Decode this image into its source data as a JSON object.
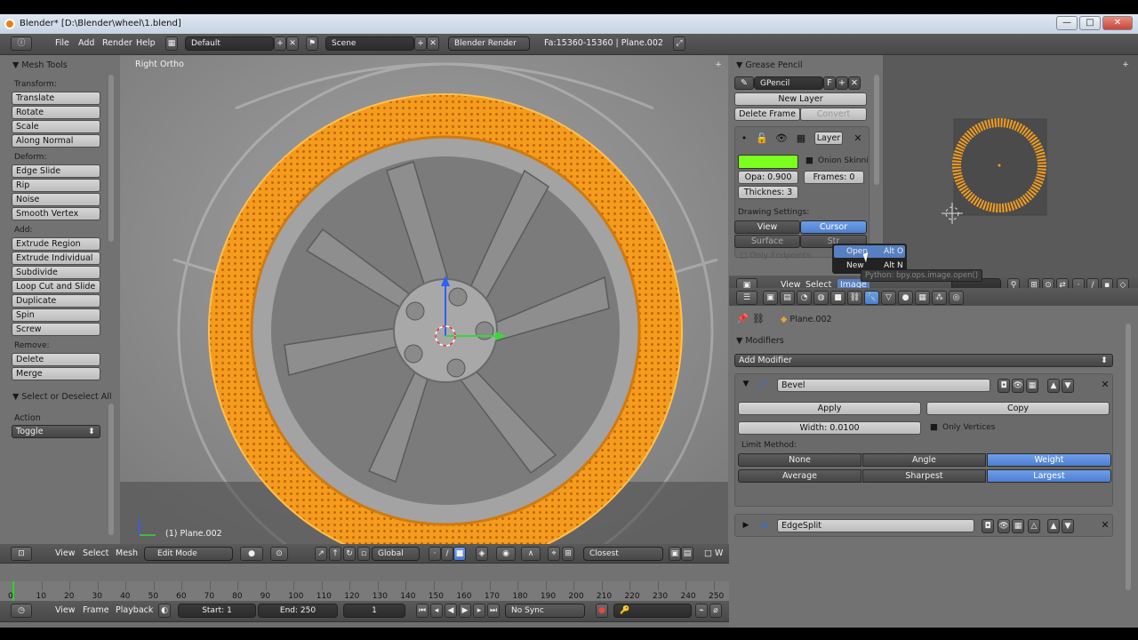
{
  "window": {
    "title": "Blender* [D:\\Blender\\wheel\\1.blend]",
    "minimize": "—",
    "maximize": "□",
    "close": "✕"
  },
  "top_header": {
    "menus": [
      "File",
      "Add",
      "Render",
      "Help"
    ],
    "layout": "Default",
    "scene": "Scene",
    "engine": "Blender Render",
    "stats": "Fa:15360-15360 | Plane.002"
  },
  "toolshelf": {
    "title": "Mesh Tools",
    "sections": [
      {
        "label": "Transform:",
        "buttons": [
          "Translate",
          "Rotate",
          "Scale",
          "Along Normal"
        ]
      },
      {
        "label": "Deform:",
        "buttons": [
          "Edge Slide",
          "Rip",
          "Noise",
          "Smooth Vertex"
        ]
      },
      {
        "label": "Add:",
        "buttons": [
          "Extrude Region",
          "Extrude Individual",
          "Subdivide",
          "Loop Cut and Slide",
          "Duplicate",
          "Spin",
          "Screw"
        ]
      },
      {
        "label": "Remove:",
        "buttons": [
          "Delete",
          "Merge"
        ]
      }
    ],
    "operator": {
      "title": "Select or Deselect All",
      "action_label": "Action",
      "action_value": "Toggle"
    }
  },
  "viewport": {
    "view_name": "Right Ortho",
    "object_label": "(1) Plane.002"
  },
  "viewport_header": {
    "menus": [
      "View",
      "Select",
      "Mesh"
    ],
    "mode": "Edit Mode",
    "orientation": "Global",
    "snap": "Closest"
  },
  "timeline": {
    "ticks": [
      "0",
      "10",
      "20",
      "30",
      "40",
      "50",
      "60",
      "70",
      "80",
      "90",
      "100",
      "110",
      "120",
      "130",
      "140",
      "150",
      "160",
      "170",
      "180",
      "190",
      "200",
      "210",
      "220",
      "230",
      "240",
      "250"
    ],
    "menus": [
      "View",
      "Frame",
      "Playback"
    ],
    "start": "Start: 1",
    "end": "End: 250",
    "current": "1",
    "sync": "No Sync"
  },
  "grease_pencil": {
    "title": "Grease Pencil",
    "name": "GPencil",
    "f_label": "F",
    "new_layer": "New Layer",
    "delete_frame": "Delete Frame",
    "convert": "Convert",
    "layer": "Layer",
    "color": "#7bff1f",
    "opacity": "Opa: 0.900",
    "onion": "Onion Skinni",
    "frames": "Frames: 0",
    "thickness": "Thicknes: 3",
    "drawing_settings": "Drawing Settings:",
    "view_btn": "View",
    "cursor_btn": "Cursor",
    "surface_btn": "Surface",
    "stroke_btn": "Str",
    "only_endpoints": "Only Endpoints"
  },
  "image_menu": {
    "items": [
      {
        "label": "Open",
        "shortcut": "Alt O"
      },
      {
        "label": "New",
        "shortcut": "Alt N"
      }
    ],
    "tooltip": "Python: bpy.ops.image.open()"
  },
  "image_editor_header": {
    "menus": [
      "View",
      "Select",
      "Image"
    ]
  },
  "properties": {
    "object": "Plane.002",
    "modifiers_title": "Modifiers",
    "add_modifier": "Add Modifier",
    "bevel": {
      "name": "Bevel",
      "apply": "Apply",
      "copy": "Copy",
      "width": "Width: 0.0100",
      "only_vertices": "Only Vertices",
      "limit_method": "Limit Method:",
      "limit_options": [
        "None",
        "Angle",
        "Weight"
      ],
      "limit_selected": "Weight",
      "angle_options": [
        "Average",
        "Sharpest",
        "Largest"
      ],
      "angle_selected": "Largest"
    },
    "edgesplit": {
      "name": "EdgeSplit"
    }
  },
  "colors": {
    "accent": "#5680c2",
    "selection_orange": "#f5a020",
    "gp_color": "#7bff1f"
  }
}
